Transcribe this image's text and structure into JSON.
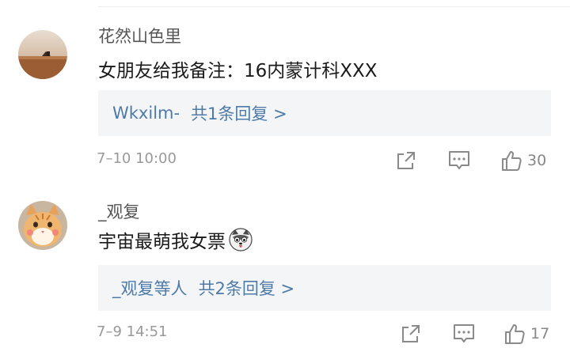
{
  "comments": [
    {
      "username": "花然山色里",
      "content": "女朋友给我备注：16内蒙计科XXX",
      "reply_summary_user": "Wkxilm-",
      "reply_summary_count": "共1条回复 >",
      "time": "7–10 10:00",
      "likes": "30",
      "avatar_icon": "desert-landscape-avatar",
      "has_emoji": false
    },
    {
      "username": "_观复",
      "content": "宇宙最萌我女票",
      "reply_summary_user": "_观复等人",
      "reply_summary_count": "共2条回复 >",
      "time": "7–9 14:51",
      "likes": "17",
      "avatar_icon": "orange-cat-avatar",
      "emoji_icon": "husky-face-emoji",
      "has_emoji": true
    }
  ],
  "icons": {
    "share": "share-icon",
    "comment": "comment-icon",
    "like": "thumbs-up-icon"
  },
  "colors": {
    "reply_link": "#4e7aa8",
    "reply_bg": "#f4f5f7",
    "meta_gray": "#999999"
  }
}
